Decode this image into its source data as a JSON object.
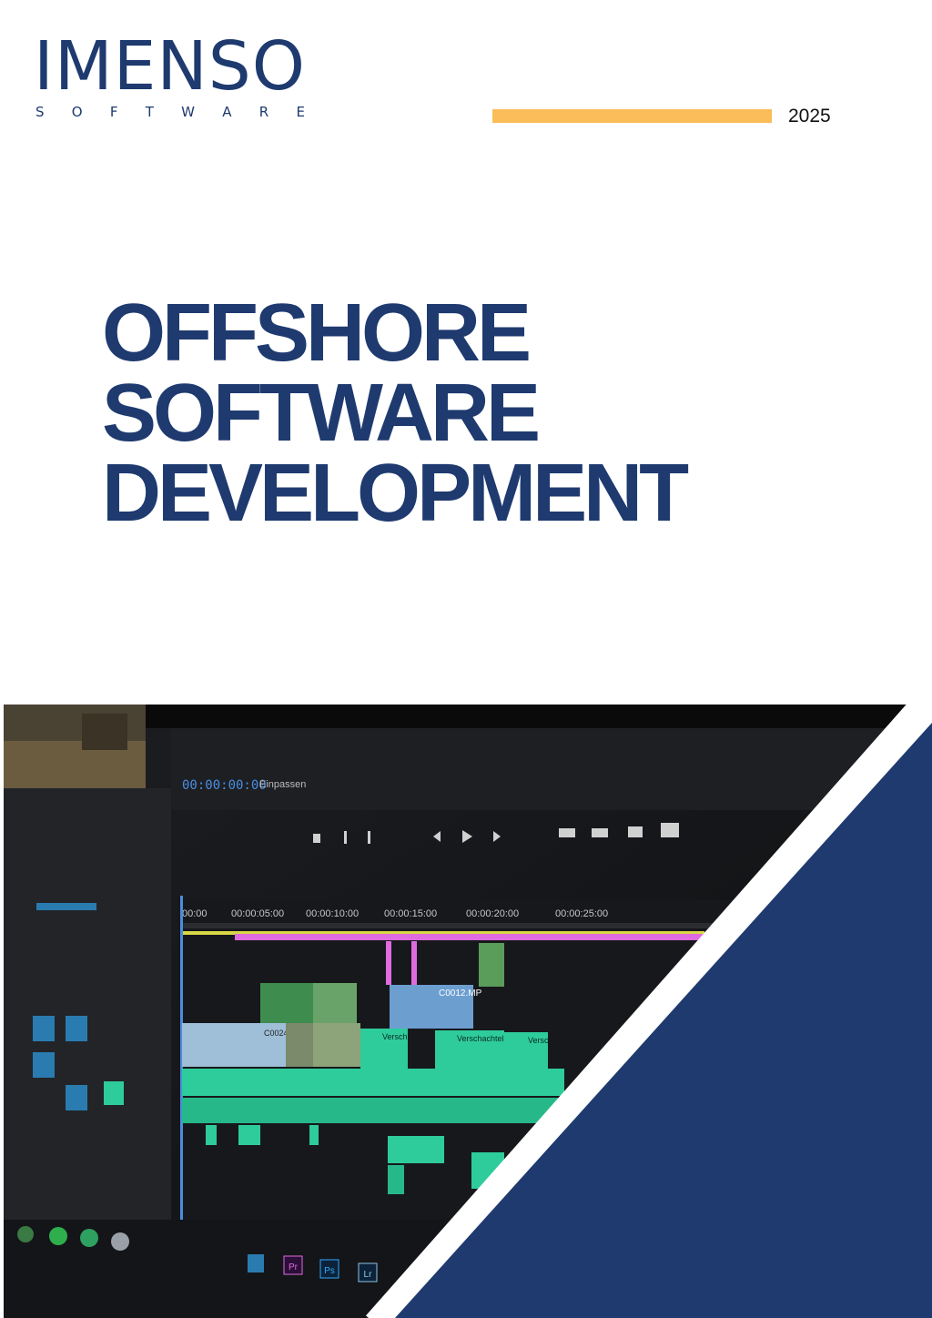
{
  "brand": {
    "name": "IMENSO",
    "tagline_letters": [
      "S",
      "O",
      "F",
      "T",
      "W",
      "A",
      "R",
      "E"
    ]
  },
  "year": "2025",
  "title_lines": [
    "OFFSHORE",
    "SOFTWARE",
    "DEVELOPMENT"
  ],
  "hero_ui": {
    "timecode": "00:00:00:00",
    "fit_label": "Einpassen",
    "ruler_times": [
      "00:00",
      "00:00:05:00",
      "00:00:10:00",
      "00:00:15:00",
      "00:00:20:00",
      "00:00:25:00"
    ],
    "clips": [
      "C0012.MP",
      "C0024",
      "Verschachtel",
      "Versch",
      "Versc"
    ],
    "dock_apps": [
      "Pr",
      "Ps",
      "Lr"
    ]
  },
  "colors": {
    "navy": "#1e3a6f",
    "accent_yellow": "#fbbd59",
    "timeline_green": "#2ecc9a",
    "timeline_pink": "#e06ae0",
    "timecode_blue": "#4a8ee0"
  }
}
